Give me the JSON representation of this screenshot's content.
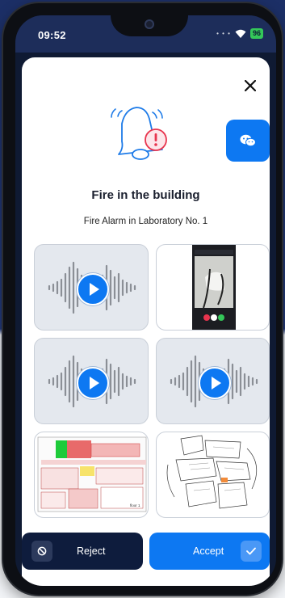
{
  "status_bar": {
    "time": "09:52",
    "battery": "96"
  },
  "dialog": {
    "title": "Fire in the building",
    "subtitle": "Fire Alarm in Laboratory No. 1"
  },
  "media": [
    {
      "type": "audio",
      "icon": "play-icon"
    },
    {
      "type": "image",
      "description_icon": "photo-icon"
    },
    {
      "type": "audio",
      "icon": "play-icon"
    },
    {
      "type": "audio",
      "icon": "play-icon"
    },
    {
      "type": "floorplan"
    },
    {
      "type": "floorplan"
    }
  ],
  "floorplan_label": "floor 1",
  "actions": {
    "reject": "Reject",
    "accept": "Accept"
  },
  "colors": {
    "accent": "#0d78f2",
    "dark": "#0e1c3d",
    "alert": "#e8344e"
  }
}
